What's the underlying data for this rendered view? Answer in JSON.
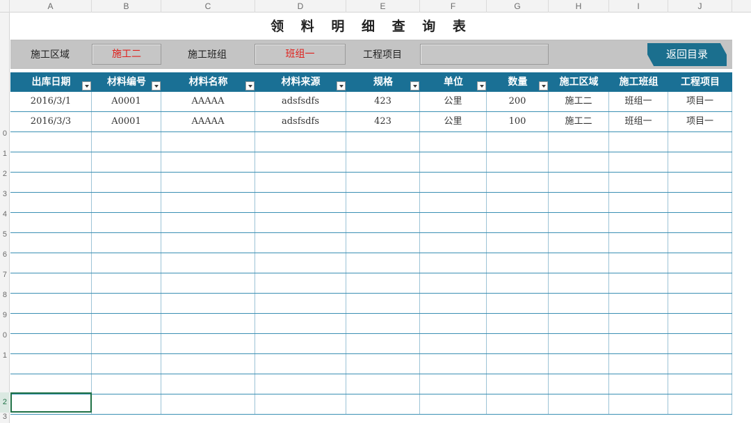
{
  "columns": [
    "A",
    "B",
    "C",
    "D",
    "E",
    "F",
    "G",
    "H",
    "I",
    "J"
  ],
  "row_numbers": [
    "",
    "",
    "",
    "",
    "",
    "",
    "",
    "",
    "",
    "0",
    "1",
    "2",
    "3",
    "4",
    "5",
    "6",
    "7",
    "8",
    "9",
    "0",
    "1",
    "2",
    "3"
  ],
  "title": "领 料 明 细 查 询 表",
  "filters": {
    "area_label": "施工区域",
    "area_value": "施工二",
    "team_label": "施工班组",
    "team_value": "班组一",
    "project_label": "工程项目",
    "project_value": ""
  },
  "return_button": "返回目录",
  "table": {
    "headers": [
      "出库日期",
      "材料编号",
      "材料名称",
      "材料来源",
      "规格",
      "单位",
      "数量",
      "施工区域",
      "施工班组",
      "工程项目"
    ],
    "rows": [
      [
        "2016/3/1",
        "A0001",
        "AAAAA",
        "adsfsdfs",
        "423",
        "公里",
        "200",
        "施工二",
        "班组一",
        "项目一"
      ],
      [
        "2016/3/3",
        "A0001",
        "AAAAA",
        "adsfsdfs",
        "423",
        "公里",
        "100",
        "施工二",
        "班组一",
        "项目一"
      ]
    ],
    "empty_rows": 14
  },
  "colors": {
    "header_bg": "#1a7095",
    "filter_bg": "#c4c4c4",
    "filter_value": "#e0201c",
    "button_bg": "#1b6f8e",
    "grid_line": "#3a8fb3"
  }
}
